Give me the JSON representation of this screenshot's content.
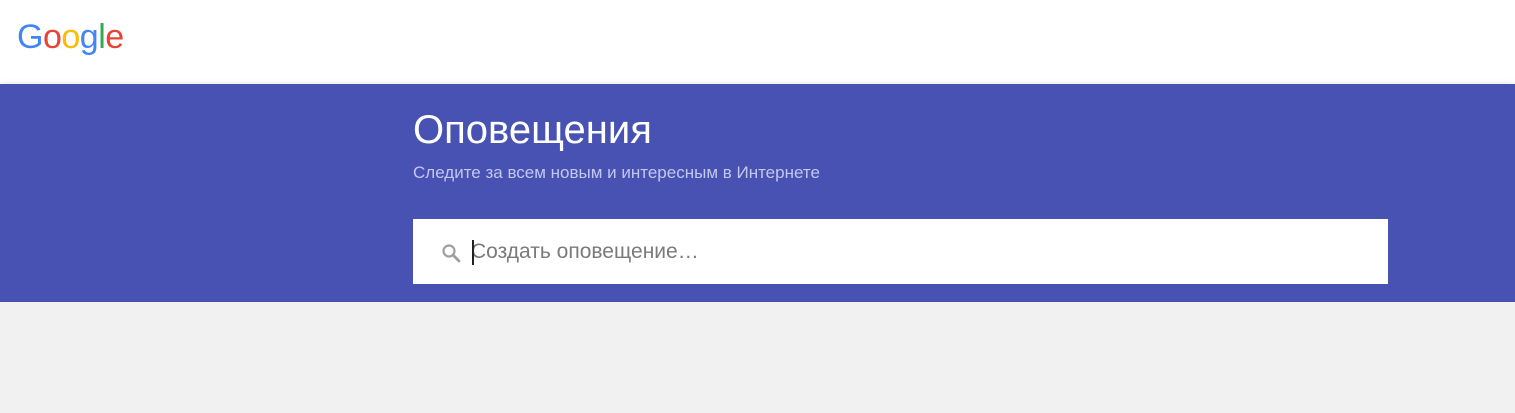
{
  "header": {
    "logo": {
      "letters": [
        {
          "char": "G",
          "color": "#4285f4"
        },
        {
          "char": "o",
          "color": "#ea4335"
        },
        {
          "char": "o",
          "color": "#fbbc05"
        },
        {
          "char": "g",
          "color": "#4285f4"
        },
        {
          "char": "l",
          "color": "#34a853"
        },
        {
          "char": "e",
          "color": "#ea4335"
        }
      ]
    }
  },
  "hero": {
    "title": "Оповещения",
    "subtitle": "Следите за всем новым и интересным в Интернете",
    "background_color": "#4752b3"
  },
  "search": {
    "placeholder": "Создать оповещение…",
    "value": "",
    "icon": "search-icon"
  }
}
